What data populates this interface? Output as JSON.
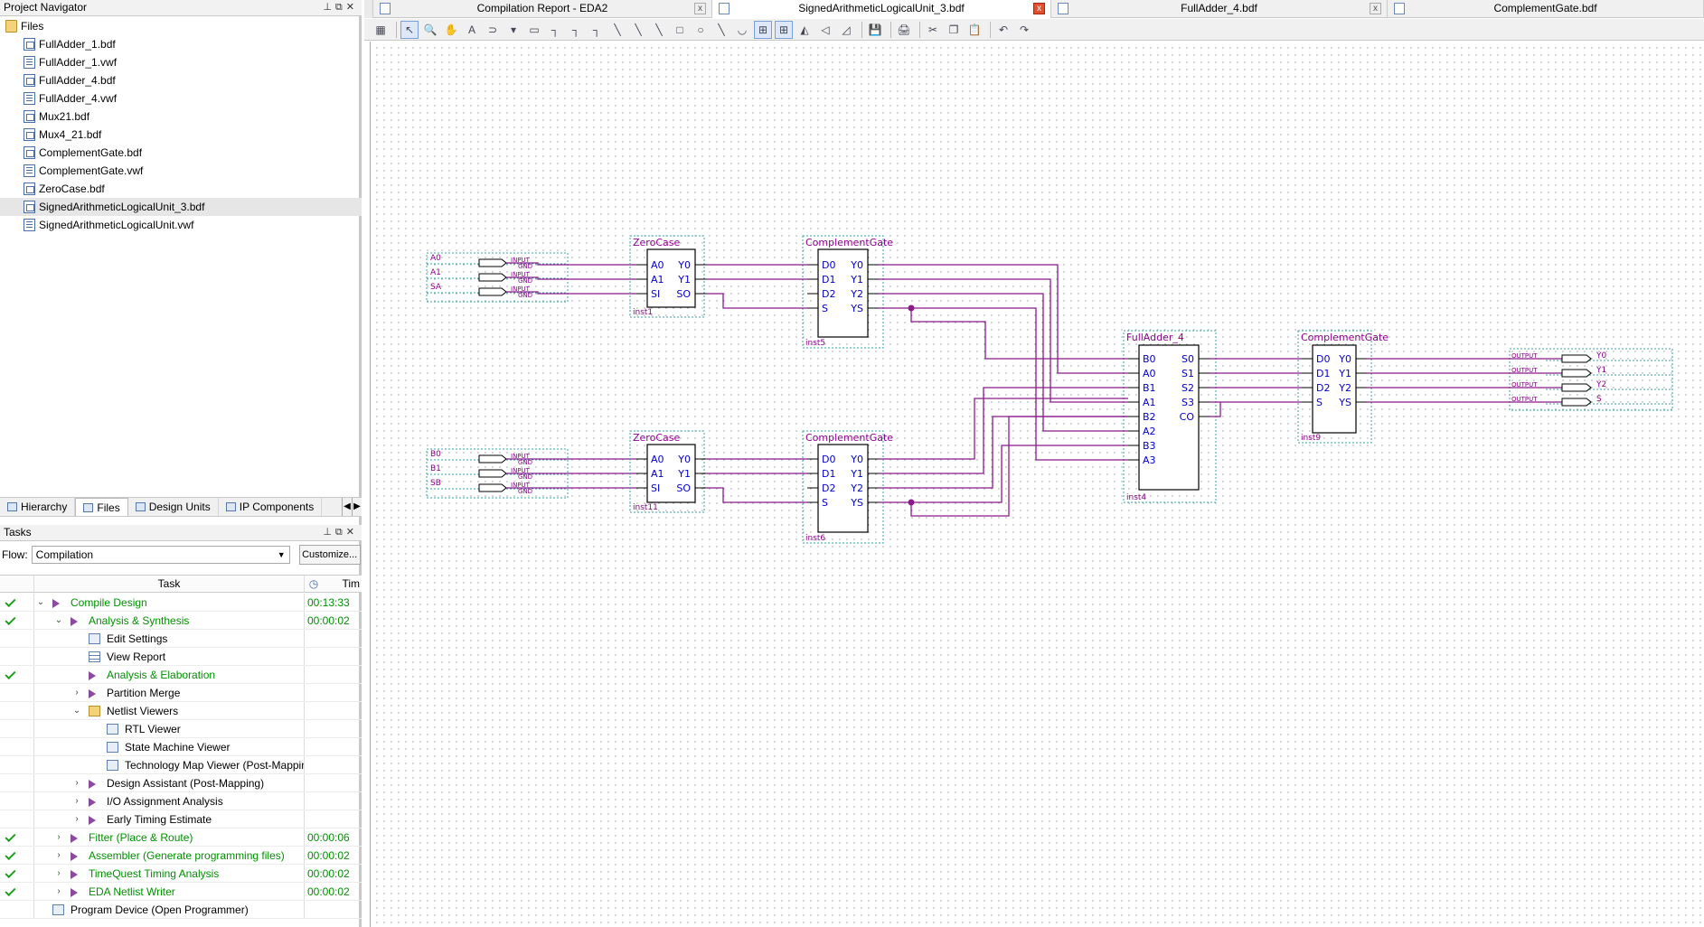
{
  "navigator": {
    "title": "Project Navigator",
    "root": "Files",
    "files": [
      {
        "name": "FullAdder_1.bdf",
        "type": "bdf"
      },
      {
        "name": "FullAdder_1.vwf",
        "type": "vwf"
      },
      {
        "name": "FullAdder_4.bdf",
        "type": "bdf"
      },
      {
        "name": "FullAdder_4.vwf",
        "type": "vwf"
      },
      {
        "name": "Mux21.bdf",
        "type": "bdf"
      },
      {
        "name": "Mux4_21.bdf",
        "type": "bdf"
      },
      {
        "name": "ComplementGate.bdf",
        "type": "bdf"
      },
      {
        "name": "ComplementGate.vwf",
        "type": "vwf"
      },
      {
        "name": "ZeroCase.bdf",
        "type": "bdf"
      },
      {
        "name": "SignedArithmeticLogicalUnit_3.bdf",
        "type": "bdf",
        "selected": true
      },
      {
        "name": "SignedArithmeticLogicalUnit.vwf",
        "type": "vwf"
      }
    ],
    "tabs": [
      "Hierarchy",
      "Files",
      "Design Units",
      "IP Components"
    ]
  },
  "tasks": {
    "title": "Tasks",
    "flow_label": "Flow:",
    "flow_value": "Compilation",
    "customize": "Customize...",
    "columns": {
      "task": "Task",
      "time": "Tim"
    },
    "rows": [
      {
        "done": true,
        "level": 0,
        "exp": "v",
        "icon": "play",
        "label": "Compile Design",
        "time": "00:13:33",
        "green": true
      },
      {
        "done": true,
        "level": 1,
        "exp": "v",
        "icon": "play",
        "label": "Analysis & Synthesis",
        "time": "00:00:02",
        "green": true
      },
      {
        "done": false,
        "level": 2,
        "exp": "",
        "icon": "box",
        "label": "Edit Settings",
        "time": "",
        "green": false
      },
      {
        "done": false,
        "level": 2,
        "exp": "",
        "icon": "table",
        "label": "View Report",
        "time": "",
        "green": false
      },
      {
        "done": true,
        "level": 2,
        "exp": "",
        "icon": "play",
        "label": "Analysis & Elaboration",
        "time": "",
        "green": true
      },
      {
        "done": false,
        "level": 2,
        "exp": ">",
        "icon": "play",
        "label": "Partition Merge",
        "time": "",
        "green": false
      },
      {
        "done": false,
        "level": 2,
        "exp": "v",
        "icon": "folder",
        "label": "Netlist Viewers",
        "time": "",
        "green": false
      },
      {
        "done": false,
        "level": 3,
        "exp": "",
        "icon": "box",
        "label": "RTL Viewer",
        "time": "",
        "green": false
      },
      {
        "done": false,
        "level": 3,
        "exp": "",
        "icon": "box",
        "label": "State Machine Viewer",
        "time": "",
        "green": false
      },
      {
        "done": false,
        "level": 3,
        "exp": "",
        "icon": "box",
        "label": "Technology Map Viewer (Post-Mapping)",
        "time": "",
        "green": false
      },
      {
        "done": false,
        "level": 2,
        "exp": ">",
        "icon": "play",
        "label": "Design Assistant (Post-Mapping)",
        "time": "",
        "green": false
      },
      {
        "done": false,
        "level": 2,
        "exp": ">",
        "icon": "play",
        "label": "I/O Assignment Analysis",
        "time": "",
        "green": false
      },
      {
        "done": false,
        "level": 2,
        "exp": ">",
        "icon": "play",
        "label": "Early Timing Estimate",
        "time": "",
        "green": false
      },
      {
        "done": true,
        "level": 1,
        "exp": ">",
        "icon": "play",
        "label": "Fitter (Place & Route)",
        "time": "00:00:06",
        "green": true
      },
      {
        "done": true,
        "level": 1,
        "exp": ">",
        "icon": "play",
        "label": "Assembler (Generate programming files)",
        "time": "00:00:02",
        "green": true
      },
      {
        "done": true,
        "level": 1,
        "exp": ">",
        "icon": "play",
        "label": "TimeQuest Timing Analysis",
        "time": "00:00:02",
        "green": true
      },
      {
        "done": true,
        "level": 1,
        "exp": ">",
        "icon": "play",
        "label": "EDA Netlist Writer",
        "time": "00:00:02",
        "green": true
      },
      {
        "done": false,
        "level": 0,
        "exp": "",
        "icon": "box",
        "label": "Program Device (Open Programmer)",
        "time": "",
        "green": false
      }
    ]
  },
  "doc_tabs": [
    {
      "label": "Compilation Report - EDA2",
      "close": "x",
      "active": false
    },
    {
      "label": "SignedArithmeticLogicalUnit_3.bdf",
      "close": "x",
      "active": true
    },
    {
      "label": "FullAdder_4.bdf",
      "close": "x",
      "active": false
    },
    {
      "label": "ComplementGate.bdf",
      "close": "",
      "active": false
    }
  ],
  "toolbar_glyphs": [
    "▦",
    "↖",
    "🔍",
    "✋",
    "A",
    "⊃",
    "▾",
    "▭",
    "┐",
    "┐",
    "┐",
    "╲",
    "╲",
    "╲",
    "□",
    "○",
    "╲",
    "◡",
    "⊞",
    "⊞",
    "◭",
    "◁",
    "◿",
    "💾",
    "🖨",
    "✂",
    "❐",
    "📋",
    "↶",
    "↷"
  ],
  "schematic": {
    "wire_color": "#8b1a8b",
    "box_label_color": "#8b008b",
    "pin_text_color": "#0000cc",
    "inputs_top": [
      {
        "name": "A0",
        "tag": "INPUT",
        "val": "GND"
      },
      {
        "name": "A1",
        "tag": "INPUT",
        "val": "GND"
      },
      {
        "name": "SA",
        "tag": "INPUT",
        "val": "GND"
      }
    ],
    "inputs_bottom": [
      {
        "name": "B0",
        "tag": "INPUT",
        "val": "GND"
      },
      {
        "name": "B1",
        "tag": "INPUT",
        "val": "GND"
      },
      {
        "name": "SB",
        "tag": "INPUT",
        "val": "GND"
      }
    ],
    "outputs": [
      {
        "name": "Y0",
        "tag": "OUTPUT"
      },
      {
        "name": "Y1",
        "tag": "OUTPUT"
      },
      {
        "name": "Y2",
        "tag": "OUTPUT"
      },
      {
        "name": "S",
        "tag": "OUTPUT"
      }
    ],
    "blocks": {
      "zc_top": {
        "title": "ZeroCase",
        "inst": "inst1",
        "in": [
          "A0",
          "A1",
          "SI"
        ],
        "out": [
          "Y0",
          "Y1",
          "SO"
        ]
      },
      "cg_top": {
        "title": "ComplementGate",
        "inst": "inst5",
        "in": [
          "D0",
          "D1",
          "D2",
          "S"
        ],
        "out": [
          "Y0",
          "Y1",
          "Y2",
          "YS"
        ]
      },
      "zc_bot": {
        "title": "ZeroCase",
        "inst": "inst11",
        "in": [
          "A0",
          "A1",
          "SI"
        ],
        "out": [
          "Y0",
          "Y1",
          "SO"
        ]
      },
      "cg_bot": {
        "title": "ComplementGate",
        "inst": "inst6",
        "in": [
          "D0",
          "D1",
          "D2",
          "S"
        ],
        "out": [
          "Y0",
          "Y1",
          "Y2",
          "YS"
        ]
      },
      "fa4": {
        "title": "FullAdder_4",
        "inst": "inst4",
        "in": [
          "B0",
          "A0",
          "B1",
          "A1",
          "B2",
          "A2",
          "B3",
          "A3"
        ],
        "out": [
          "S0",
          "S1",
          "S2",
          "S3",
          "CO"
        ]
      },
      "cg_out": {
        "title": "ComplementGate",
        "inst": "inst9",
        "in": [
          "D0",
          "D1",
          "D2",
          "S"
        ],
        "out": [
          "Y0",
          "Y1",
          "Y2",
          "YS"
        ]
      }
    }
  }
}
